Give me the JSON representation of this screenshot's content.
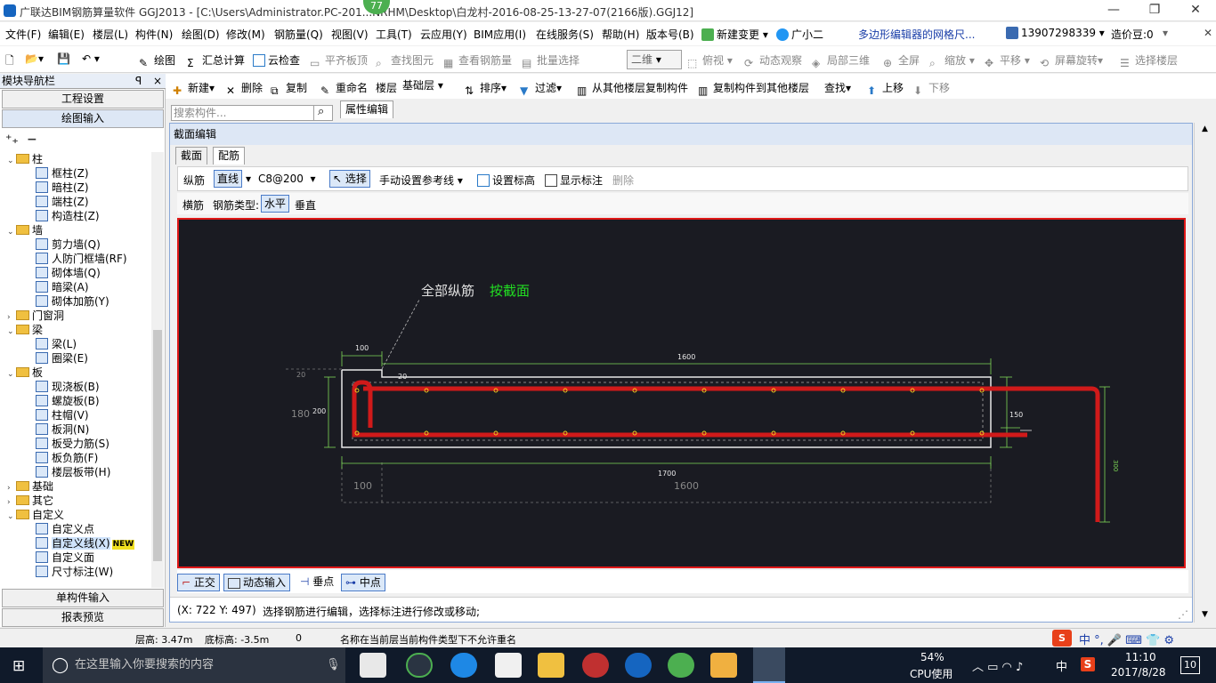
{
  "window": {
    "title": "广联达BIM钢筋算量软件 GGJ2013 - [C:\\Users\\Administrator.PC-201...NRHM\\Desktop\\白龙村-2016-08-25-13-27-07(2166版).GGJ12]",
    "badge": "77"
  },
  "menubar": {
    "items": [
      "文件(F)",
      "编辑(E)",
      "楼层(L)",
      "构件(N)",
      "绘图(D)",
      "修改(M)",
      "钢筋量(Q)",
      "视图(V)",
      "工具(T)",
      "云应用(Y)",
      "BIM应用(I)",
      "在线服务(S)",
      "帮助(H)",
      "版本号(B)",
      "新建变更",
      "广小二"
    ],
    "notice": "多边形编辑器的网格尺...",
    "phone": "13907298339",
    "cost": "造价豆:0"
  },
  "toolbar1": {
    "draw": "绘图",
    "sum": "汇总计算",
    "cloudcheck": "云检查",
    "flat": "平齐板顶",
    "findelem": "查找图元",
    "viewrebar": "查看钢筋量",
    "batchsel": "批量选择",
    "view2d": "二维",
    "topview": "俯视",
    "dynview": "动态观察",
    "local3d": "局部三维",
    "fullscreen": "全屏",
    "zoom": "缩放",
    "pan": "平移",
    "rotate": "屏幕旋转",
    "selfloor": "选择楼层"
  },
  "nav": {
    "header": "模块导航栏",
    "pin": "ꟼ",
    "close": "×",
    "project_settings": "工程设置",
    "drawing_input": "绘图输入",
    "single_input": "单构件输入",
    "report": "报表预览",
    "tree": [
      {
        "label": "柱",
        "type": "folder",
        "exp": "⌄",
        "indent": 0
      },
      {
        "label": "框柱(Z)",
        "type": "leaf",
        "indent": 1
      },
      {
        "label": "暗柱(Z)",
        "type": "leaf",
        "indent": 1
      },
      {
        "label": "端柱(Z)",
        "type": "leaf",
        "indent": 1
      },
      {
        "label": "构造柱(Z)",
        "type": "leaf",
        "indent": 1
      },
      {
        "label": "墙",
        "type": "folder",
        "exp": "⌄",
        "indent": 0
      },
      {
        "label": "剪力墙(Q)",
        "type": "leaf",
        "indent": 1
      },
      {
        "label": "人防门框墙(RF)",
        "type": "leaf",
        "indent": 1
      },
      {
        "label": "砌体墙(Q)",
        "type": "leaf",
        "indent": 1
      },
      {
        "label": "暗梁(A)",
        "type": "leaf",
        "indent": 1
      },
      {
        "label": "砌体加筋(Y)",
        "type": "leaf",
        "indent": 1
      },
      {
        "label": "门窗洞",
        "type": "folder",
        "exp": "›",
        "indent": 0
      },
      {
        "label": "梁",
        "type": "folder",
        "exp": "⌄",
        "indent": 0
      },
      {
        "label": "梁(L)",
        "type": "leaf",
        "indent": 1
      },
      {
        "label": "圈梁(E)",
        "type": "leaf",
        "indent": 1
      },
      {
        "label": "板",
        "type": "folder",
        "exp": "⌄",
        "indent": 0
      },
      {
        "label": "现浇板(B)",
        "type": "leaf",
        "indent": 1
      },
      {
        "label": "螺旋板(B)",
        "type": "leaf",
        "indent": 1
      },
      {
        "label": "柱帽(V)",
        "type": "leaf",
        "indent": 1
      },
      {
        "label": "板洞(N)",
        "type": "leaf",
        "indent": 1
      },
      {
        "label": "板受力筋(S)",
        "type": "leaf",
        "indent": 1
      },
      {
        "label": "板负筋(F)",
        "type": "leaf",
        "indent": 1
      },
      {
        "label": "楼层板带(H)",
        "type": "leaf",
        "indent": 1
      },
      {
        "label": "基础",
        "type": "folder",
        "exp": "›",
        "indent": 0
      },
      {
        "label": "其它",
        "type": "folder",
        "exp": "›",
        "indent": 0
      },
      {
        "label": "自定义",
        "type": "folder",
        "exp": "⌄",
        "indent": 0
      },
      {
        "label": "自定义点",
        "type": "leaf",
        "indent": 1
      },
      {
        "label": "自定义线(X)",
        "type": "leaf",
        "indent": 1,
        "selected": true
      },
      {
        "label": "自定义面",
        "type": "leaf",
        "indent": 1
      },
      {
        "label": "尺寸标注(W)",
        "type": "leaf",
        "indent": 1
      }
    ],
    "new_badge": "NEW"
  },
  "listtoolbar": {
    "new": "新建",
    "delete": "删除",
    "copy": "复制",
    "rename": "重命名",
    "floor_label": "楼层",
    "floor_value": "基础层",
    "sort": "排序",
    "filter": "过滤",
    "copy_from": "从其他楼层复制构件",
    "copy_to": "复制构件到其他楼层",
    "find": "查找",
    "moveup": "上移",
    "movedown": "下移"
  },
  "search": {
    "placeholder": "搜索构件..."
  },
  "propedit": "属性编辑",
  "dialog": {
    "title": "截面编辑",
    "tab_section": "截面",
    "tab_rebar": "配筋",
    "long_rebar": "纵筋",
    "line_mode": "直线",
    "rebar_spec": "C8@200",
    "select": "选择",
    "manual_ref": "手动设置参考线",
    "set_elev": "设置标高",
    "show_anno": "显示标注",
    "delete": "删除",
    "trans_rebar": "横筋",
    "rebar_type_label": "钢筋类型:",
    "horizontal": "水平",
    "vertical": "垂直"
  },
  "drawing": {
    "annotation_white": "全部纵筋",
    "annotation_green": "按截面",
    "dim_100_top": "100",
    "dim_1600_top": "1600",
    "dim_20_left": "20",
    "dim_20_right": "20",
    "dim_180": "180",
    "dim_200": "200",
    "dim_150": "150",
    "dim_1700": "1700",
    "dim_100_bottom": "100",
    "dim_1600_bottom": "1600",
    "dim_300": "300"
  },
  "snaps": {
    "ortho": "正交",
    "dyninput": "动态输入",
    "perp": "垂点",
    "mid": "中点"
  },
  "coord": {
    "xy": "(X: 722 Y: 497)",
    "hint": "选择钢筋进行编辑，选择标注进行修改或移动;"
  },
  "status": {
    "floor_height": "层高: 3.47m",
    "bottom_elev": "底标高: -3.5m",
    "zero": "0",
    "message": "名称在当前层当前构件类型下不允许重名"
  },
  "taskbar": {
    "search_placeholder": "在这里输入你要搜索的内容",
    "cpu_percent": "54%",
    "cpu_label": "CPU使用",
    "ime": "中",
    "time": "11:10",
    "date": "2017/8/28",
    "notif": "10"
  },
  "colors": {
    "canvas_bg": "#1a1b22",
    "rebar_red": "#d01a1a",
    "dim_green": "#7ed957",
    "canvas_border": "#e01818"
  }
}
